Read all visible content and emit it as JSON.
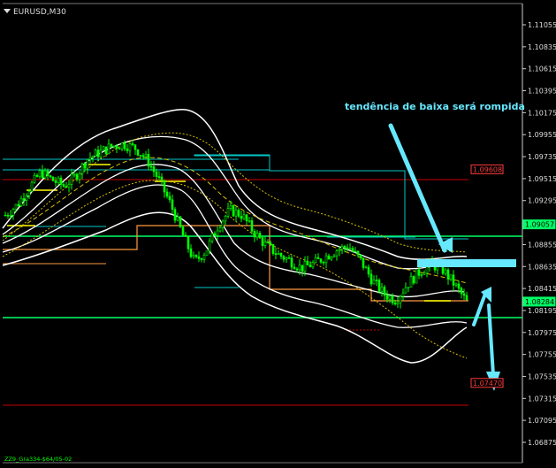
{
  "header": {
    "symbol_label": "EURUSD,M30",
    "menu_icon": "triangle-down-icon"
  },
  "footer": {
    "indicator_label": "ZZ9_Gra334-$64/05-02"
  },
  "annotation": {
    "text": "tendência de baixa será rompida"
  },
  "colors": {
    "background": "#000000",
    "candle": "#00ff00",
    "cyan_level": "#00c8c8",
    "resistance_red": "#c80000",
    "green_level": "#00ff66",
    "orange_level": "#ff9a40",
    "yellow": "#ffff00",
    "band_white": "#ffffff",
    "arrow": "#66e8ff",
    "label_red_bg": "#ff3b3b"
  },
  "chart_data": {
    "type": "candlestick",
    "symbol": "EURUSD",
    "timeframe": "M30",
    "y_ticks": [
      "1.11055",
      "1.10835",
      "1.10615",
      "1.10395",
      "1.10175",
      "1.09955",
      "1.09735",
      "1.09515",
      "1.09295",
      "1.09057",
      "1.08855",
      "1.08635",
      "1.08415",
      "1.08284",
      "1.08195",
      "1.07975",
      "1.07755",
      "1.07535",
      "1.07315",
      "1.07095",
      "1.06875"
    ],
    "ylim": [
      1.0683,
      1.1124
    ],
    "price_labels": [
      {
        "value": 1.09608,
        "text": "1.09608",
        "style": "red"
      },
      {
        "value": 1.09057,
        "text": "1.09057",
        "style": "green"
      },
      {
        "value": 1.08284,
        "text": "1.08284",
        "style": "green"
      },
      {
        "value": 1.0747,
        "text": "1.07470",
        "style": "red"
      }
    ],
    "close_path": [
      1.0915,
      1.0925,
      1.0942,
      1.0958,
      1.095,
      1.0944,
      1.0955,
      1.0972,
      1.0978,
      1.0984,
      1.0986,
      1.0982,
      1.097,
      1.095,
      1.0925,
      1.0895,
      1.0868,
      1.088,
      1.0905,
      1.092,
      1.0915,
      1.0898,
      1.0885,
      1.0876,
      1.087,
      1.0862,
      1.0866,
      1.0873,
      1.088,
      1.0884,
      1.087,
      1.085,
      1.0836,
      1.083,
      1.0846,
      1.0858,
      1.0866,
      1.086,
      1.0845,
      1.0828
    ],
    "grid": false,
    "legend": "none"
  }
}
